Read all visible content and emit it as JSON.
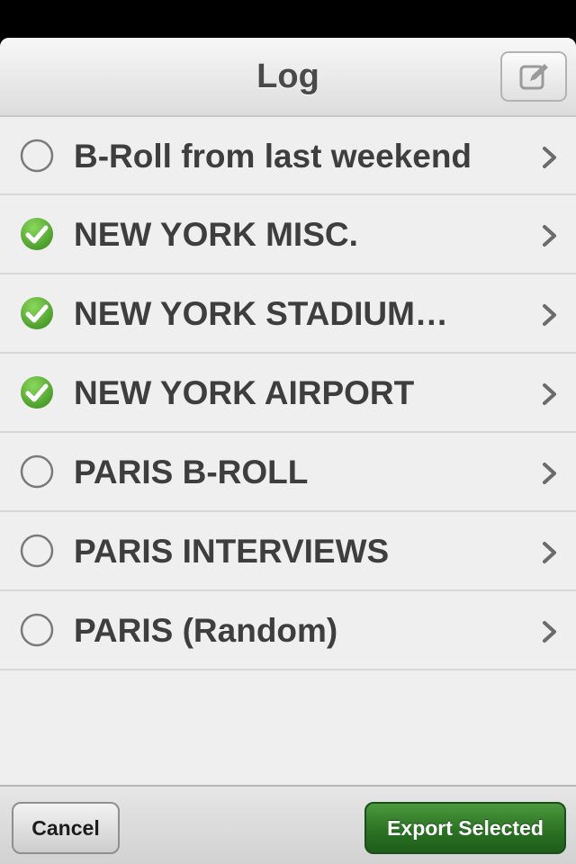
{
  "header": {
    "title": "Log",
    "edit_icon": "compose-icon"
  },
  "list": {
    "items": [
      {
        "label": "B-Roll from last weekend",
        "selected": false
      },
      {
        "label": "NEW YORK MISC.",
        "selected": true
      },
      {
        "label": "NEW YORK STADIUM…",
        "selected": true
      },
      {
        "label": "NEW YORK AIRPORT",
        "selected": true
      },
      {
        "label": "PARIS B-ROLL",
        "selected": false
      },
      {
        "label": "PARIS INTERVIEWS",
        "selected": false
      },
      {
        "label": "PARIS (Random)",
        "selected": false
      }
    ]
  },
  "toolbar": {
    "cancel_label": "Cancel",
    "export_label": "Export Selected"
  },
  "colors": {
    "check_green": "#5fb436",
    "export_green": "#2c7224",
    "text": "#3e3e3e"
  }
}
